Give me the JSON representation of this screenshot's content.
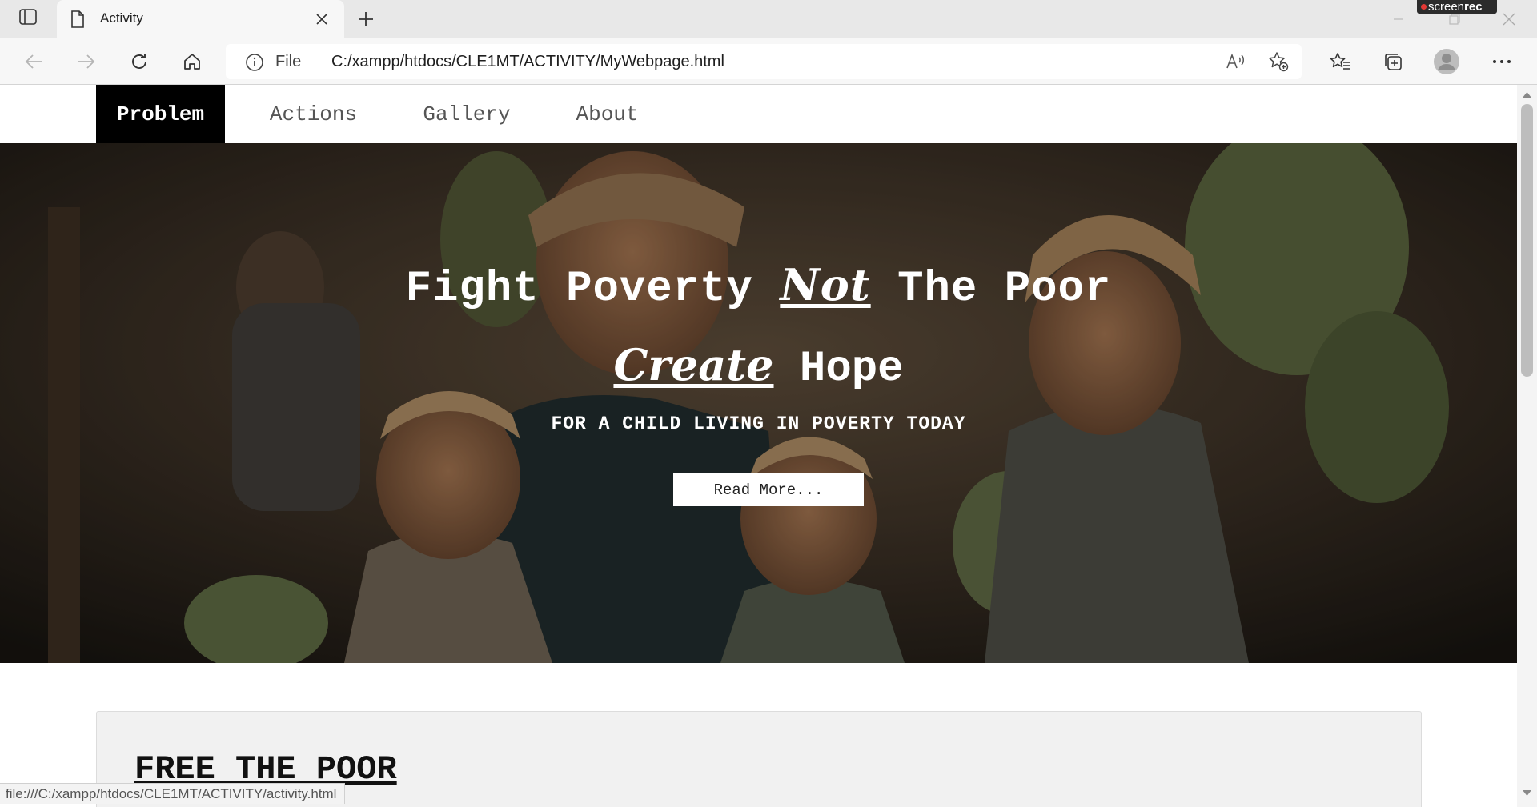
{
  "browser": {
    "tab": {
      "title": "Activity",
      "close_glyph": "✕"
    },
    "new_tab_glyph": "+",
    "screen_recorder_badge": {
      "prefix": "screen",
      "suffix": "rec"
    },
    "address_bar": {
      "scheme_label": "File",
      "url": "C:/xampp/htdocs/CLE1MT/ACTIVITY/MyWebpage.html"
    },
    "icons": [
      "tab-actions-icon",
      "page-icon",
      "close-icon",
      "plus-icon",
      "back-arrow-icon",
      "forward-arrow-icon",
      "reload-icon",
      "home-icon",
      "info-icon",
      "read-aloud-icon",
      "add-favorite-icon",
      "favorites-icon",
      "collections-icon",
      "profile-icon",
      "more-icon",
      "minimize-icon",
      "maximize-icon",
      "close-window-icon"
    ],
    "status_link_preview": "file:///C:/xampp/htdocs/CLE1MT/ACTIVITY/activity.html"
  },
  "site": {
    "nav": {
      "problem": "Problem",
      "actions": "Actions",
      "gallery": "Gallery",
      "about": "About",
      "active": "Problem"
    },
    "hero": {
      "line1": {
        "before": "Fight Poverty ",
        "emphasis": "Not",
        "after": " The Poor"
      },
      "line2": {
        "emphasis": "Create",
        "after": " Hope"
      },
      "subtitle": "FOR A CHILD LIVING IN POVERTY TODAY",
      "button_label": "Read More...",
      "image": "photo of a woman and three children carrying bananas"
    },
    "section": {
      "heading": "FREE THE POOR"
    }
  },
  "colors": {
    "nav_active_bg": "#000000",
    "hero_text": "#ffffff",
    "card_bg": "#f1f1f1",
    "chrome_bg": "#e8e8e8"
  }
}
